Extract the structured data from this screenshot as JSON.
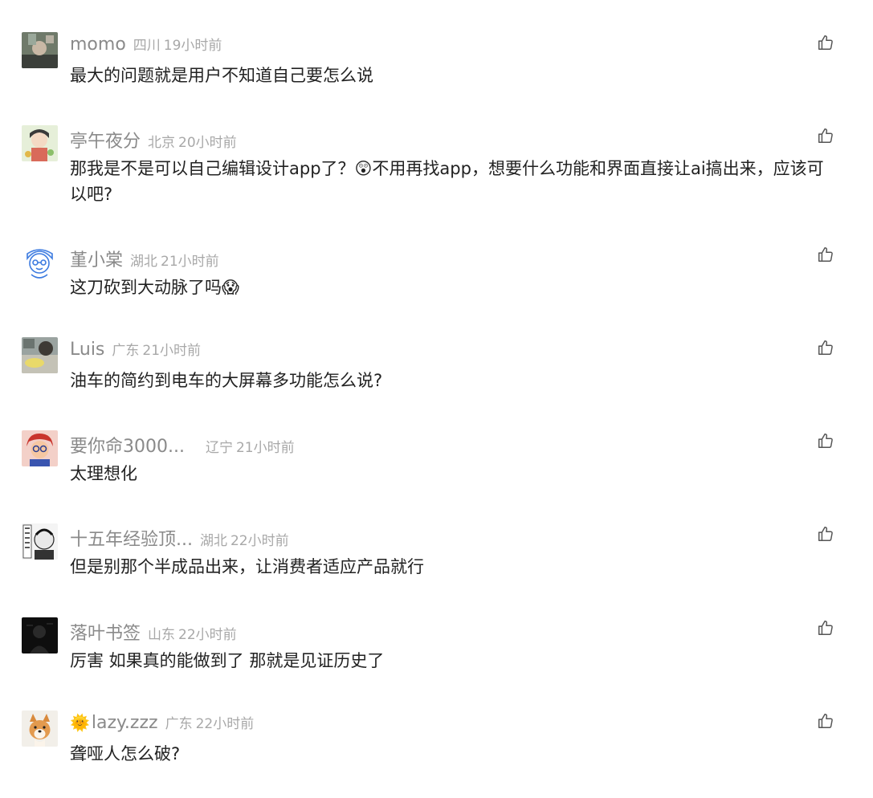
{
  "comments": [
    {
      "username": "momo",
      "location": "四川",
      "time": "19小时前",
      "content": "最大的问题就是用户不知道自己要怎么说",
      "avatar": "photo-avatar"
    },
    {
      "username": "亭午夜分",
      "location": "北京",
      "time": "20小时前",
      "content": "那我是不是可以自己编辑设计app了？😲不用再找app，想要什么功能和界面直接让ai搞出来，应该可以吧?",
      "avatar": "anime-avatar"
    },
    {
      "username": "堇小棠",
      "location": "湖北",
      "time": "21小时前",
      "content": "这刀砍到大动脉了吗😱",
      "avatar": "cartoon-boy-avatar"
    },
    {
      "username": "Luis",
      "location": "广东",
      "time": "21小时前",
      "content": "油车的简约到电车的大屏幕多功能怎么说?",
      "avatar": "photo-avatar"
    },
    {
      "username": "要你命3000...",
      "location": "辽宁",
      "time": "21小时前",
      "content": "太理想化",
      "avatar": "cartoon-face-avatar"
    },
    {
      "username": "十五年经验顶...",
      "location": "湖北",
      "time": "22小时前",
      "content": "但是别那个半成品出来，让消费者适应产品就行",
      "avatar": "manga-avatar"
    },
    {
      "username": "落叶书签",
      "location": "山东",
      "time": "22小时前",
      "content": "厉害 如果真的能做到了 那就是见证历史了",
      "avatar": "dark-avatar"
    },
    {
      "username": "lazy.zzz",
      "username_prefix": "🌞",
      "location": "广东",
      "time": "22小时前",
      "content": "聋哑人怎么破?",
      "avatar": "dog-avatar"
    }
  ],
  "like_icon": "thumbs-up-icon",
  "colors": {
    "username": "#8a8a8a",
    "meta": "#a8a8a8",
    "content": "#222222",
    "icon": "#555555"
  }
}
